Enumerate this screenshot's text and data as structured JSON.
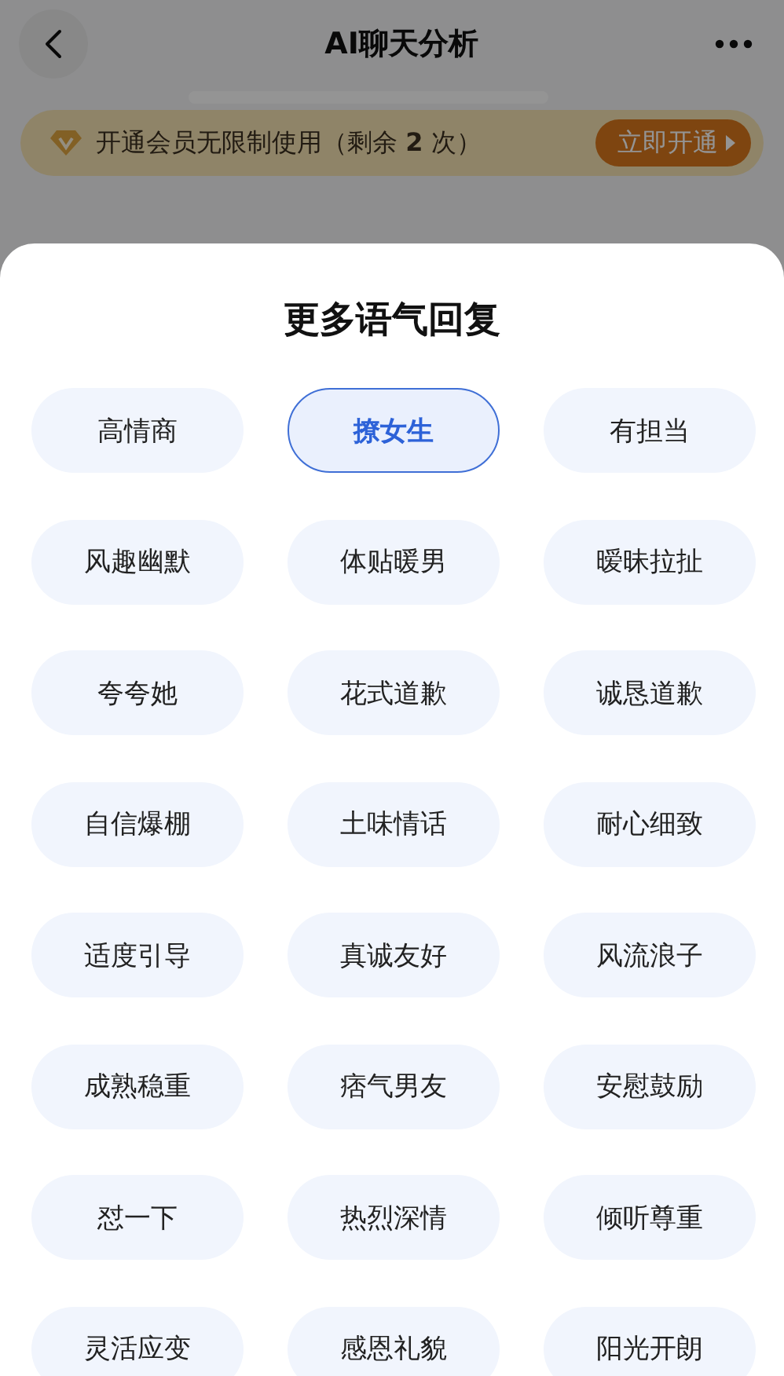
{
  "header": {
    "title": "AI聊天分析"
  },
  "banner": {
    "text": "开通会员无限制使用（剩余 **2** 次）",
    "button": "立即开通"
  },
  "sheet": {
    "title": "更多语气回复",
    "options": [
      {
        "label": "高情商",
        "selected": false
      },
      {
        "label": "撩女生",
        "selected": true
      },
      {
        "label": "有担当",
        "selected": false
      },
      {
        "label": "风趣幽默",
        "selected": false
      },
      {
        "label": "体贴暖男",
        "selected": false
      },
      {
        "label": "暧昧拉扯",
        "selected": false
      },
      {
        "label": "夸夸她",
        "selected": false
      },
      {
        "label": "花式道歉",
        "selected": false
      },
      {
        "label": "诚恳道歉",
        "selected": false
      },
      {
        "label": "自信爆棚",
        "selected": false
      },
      {
        "label": "土味情话",
        "selected": false
      },
      {
        "label": "耐心细致",
        "selected": false
      },
      {
        "label": "适度引导",
        "selected": false
      },
      {
        "label": "真诚友好",
        "selected": false
      },
      {
        "label": "风流浪子",
        "selected": false
      },
      {
        "label": "成熟稳重",
        "selected": false
      },
      {
        "label": "痞气男友",
        "selected": false
      },
      {
        "label": "安慰鼓励",
        "selected": false
      },
      {
        "label": "怼一下",
        "selected": false
      },
      {
        "label": "热烈深情",
        "selected": false
      },
      {
        "label": "倾听尊重",
        "selected": false
      },
      {
        "label": "灵活应变",
        "selected": false
      },
      {
        "label": "感恩礼貌",
        "selected": false
      },
      {
        "label": "阳光开朗",
        "selected": false
      }
    ]
  }
}
